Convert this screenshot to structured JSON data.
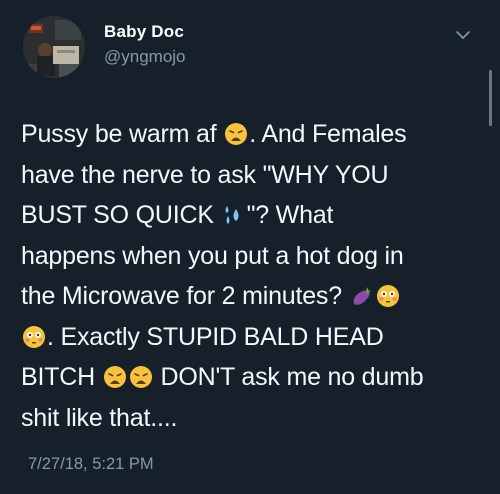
{
  "author": {
    "display_name": "Baby Doc",
    "handle": "@yngmojo"
  },
  "tweet": {
    "segments": {
      "s1": "Pussy be warm af ",
      "s2": ". And Females",
      "s3": "have the nerve to ask \"WHY YOU",
      "s4": "BUST SO QUICK ",
      "s5": "\"? What",
      "s6": "happens when you put a hot dog in",
      "s7": "the Microwave for 2 minutes? ",
      "s8": ". Exactly STUPID BALD HEAD",
      "s9": "BITCH ",
      "s10": " DON'T ask me no dumb",
      "s11": "shit like that...."
    },
    "emoji": [
      "weary-face",
      "sweat-droplets",
      "eggplant",
      "flushed-face",
      "flushed-face",
      "weary-face",
      "weary-face"
    ]
  },
  "timestamp": "7/27/18, 5:21 PM",
  "colors": {
    "background": "#15202b",
    "secondary_text": "#8899a6",
    "primary_text": "#ffffff"
  }
}
